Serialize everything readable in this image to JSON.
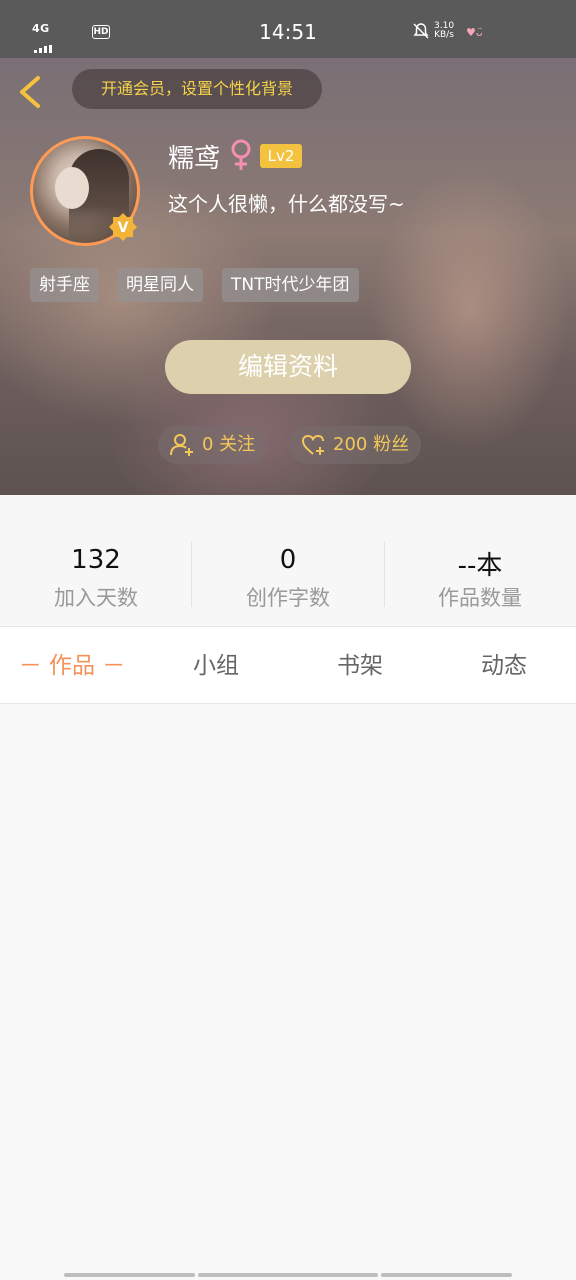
{
  "status_bar": {
    "network": "4G",
    "hd": "HD",
    "time": "14:51",
    "speed_value": "3.10",
    "speed_unit": "KB/s"
  },
  "header": {
    "vip_banner": "开通会员，设置个性化背景"
  },
  "profile": {
    "username": "糯鸢",
    "gender_symbol": "♀",
    "level": "Lv2",
    "bio": "这个人很懒，什么都没写~",
    "avatar_badge": "V",
    "tags": [
      "射手座",
      "明星同人",
      "TNT时代少年团"
    ],
    "edit_button": "编辑资料",
    "following": "0 关注",
    "fans": "200 粉丝"
  },
  "stats": [
    {
      "value": "132",
      "label": "加入天数"
    },
    {
      "value": "0",
      "label": "创作字数"
    },
    {
      "value": "--本",
      "label": "作品数量"
    }
  ],
  "tabs": [
    {
      "label": "－ 作品 －",
      "active": true
    },
    {
      "label": "小组",
      "active": false
    },
    {
      "label": "书架",
      "active": false
    },
    {
      "label": "动态",
      "active": false
    }
  ],
  "colors": {
    "accent": "#f5915a",
    "gold": "#f3c33f",
    "gender_pink": "#f48fb1",
    "edit_button_bg": "#ddd1ad"
  }
}
